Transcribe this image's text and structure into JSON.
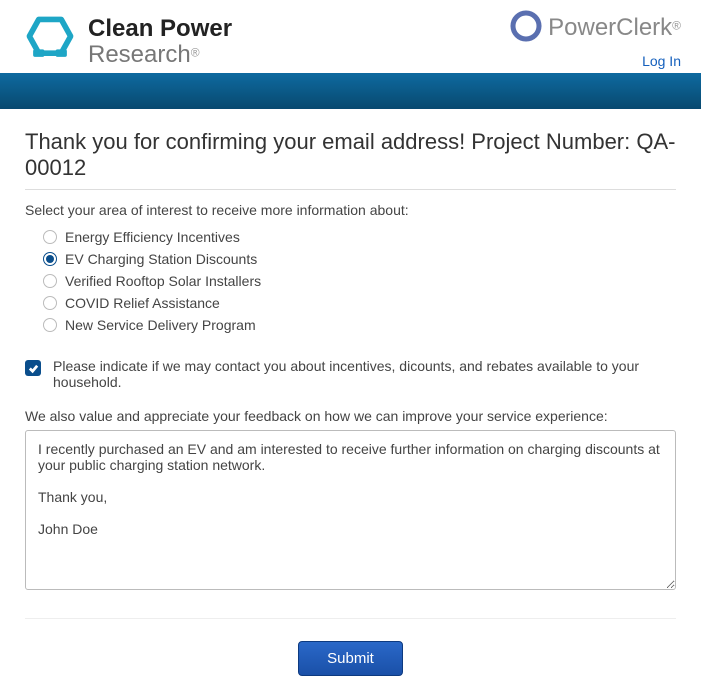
{
  "header": {
    "logo_left": {
      "line1": "Clean Power",
      "line2": "Research"
    },
    "logo_right": {
      "text": "PowerClerk"
    },
    "login_label": "Log In"
  },
  "page": {
    "title": "Thank you for confirming your email address! Project Number: QA-00012"
  },
  "form": {
    "interest_label": "Select your area of interest to receive more information about:",
    "interest_selected_index": 1,
    "interest_options": [
      "Energy Efficiency Incentives",
      "EV Charging Station Discounts",
      "Verified Rooftop Solar Installers",
      "COVID Relief Assistance",
      "New Service Delivery Program"
    ],
    "contact_checkbox_checked": true,
    "contact_label": "Please indicate if we may contact you about incentives, dicounts, and rebates available to your household.",
    "feedback_label": "We also value and appreciate your feedback on how we can improve your service experience:",
    "feedback_value": "I recently purchased an EV and am interested to receive further information on charging discounts at your public charging station network.\n\nThank you,\n\nJohn Doe",
    "submit_label": "Submit"
  }
}
